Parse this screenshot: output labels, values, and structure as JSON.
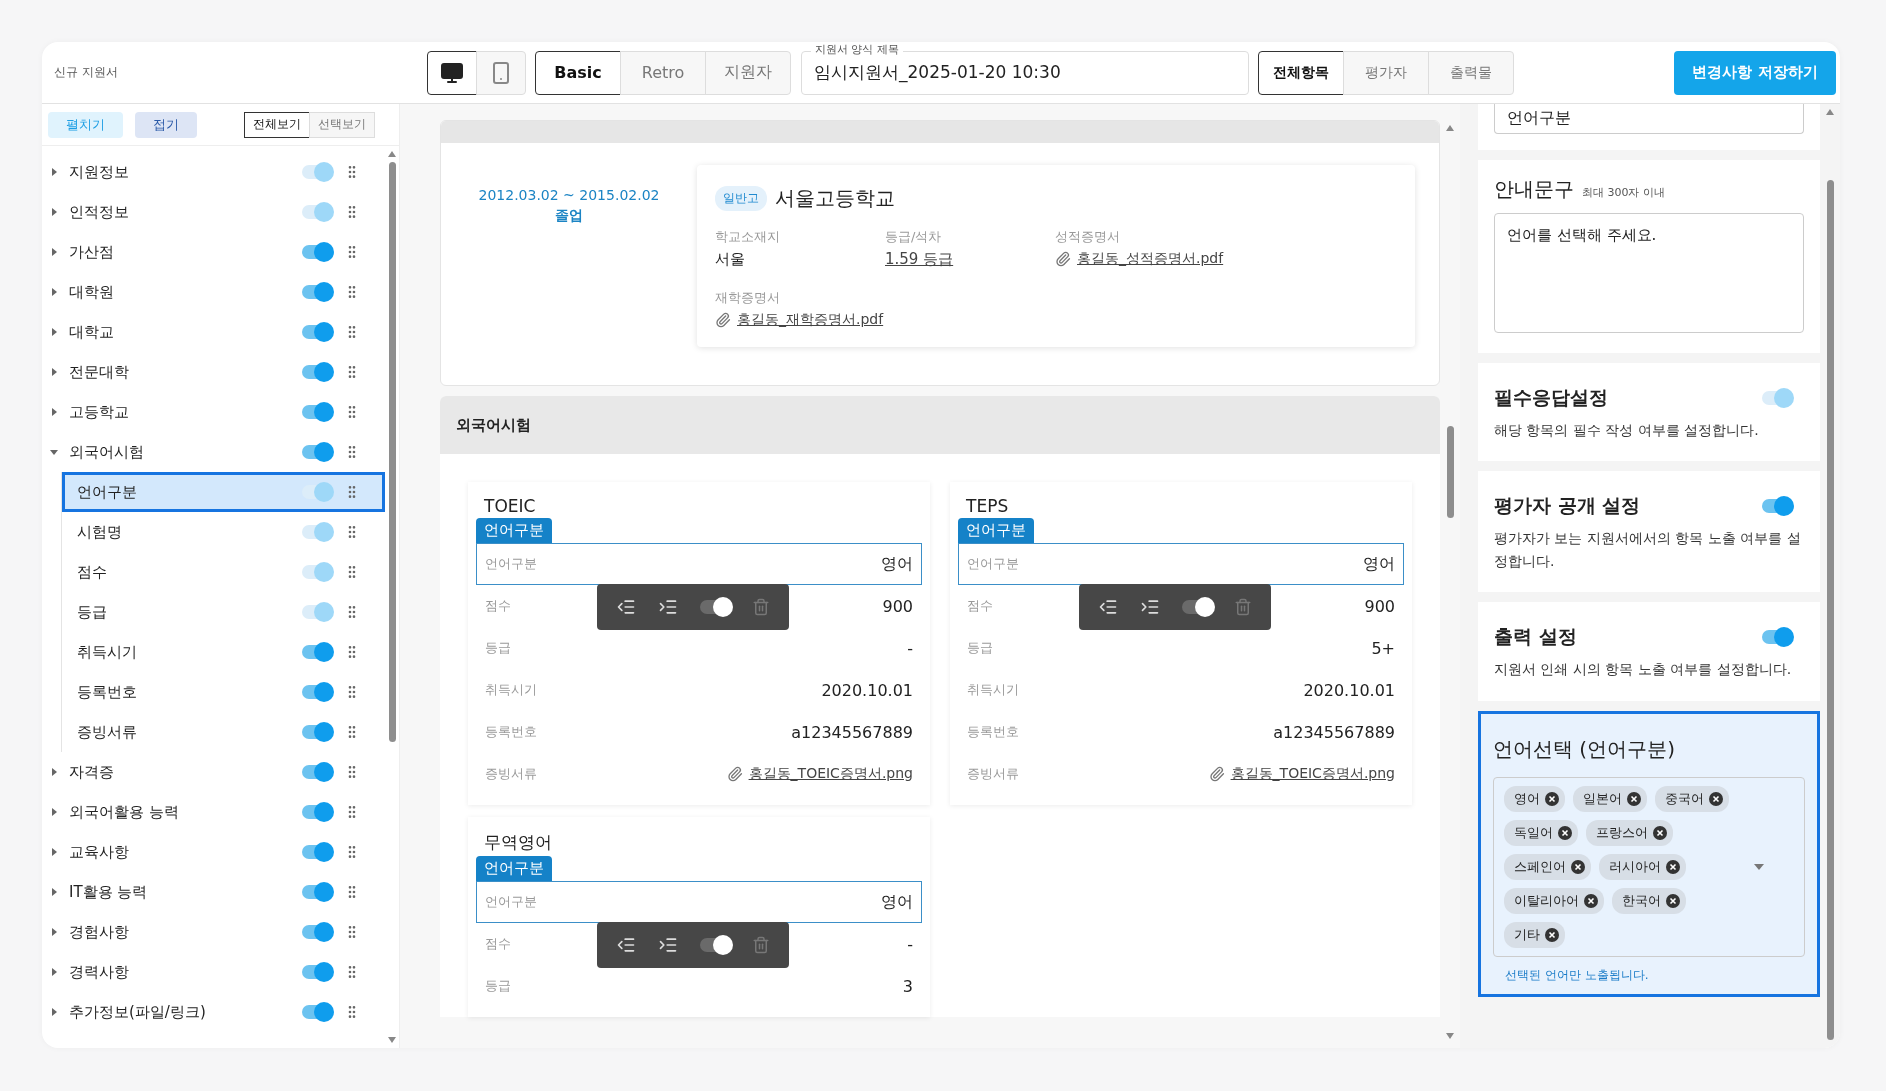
{
  "header": {
    "title": "신규 지원서",
    "view_modes": [
      {
        "kind": "desktop",
        "selected": true
      },
      {
        "kind": "mobile",
        "selected": false
      }
    ],
    "themes": [
      {
        "label": "Basic",
        "selected": true
      },
      {
        "label": "Retro",
        "selected": false
      },
      {
        "label": "지원자",
        "selected": false
      }
    ],
    "form_title": {
      "label": "지원서 양식 제목",
      "value": "임시지원서_2025-01-20 10:30"
    },
    "audiences": [
      {
        "label": "전체항목",
        "selected": true
      },
      {
        "label": "평가자",
        "selected": false
      },
      {
        "label": "출력물",
        "selected": false
      }
    ],
    "save_button": "변경사항 저장하기"
  },
  "sidebar": {
    "expand_button": "펼치기",
    "collapse_button": "접기",
    "view_tabs": [
      {
        "label": "전체보기",
        "selected": true
      },
      {
        "label": "선택보기",
        "selected": false
      }
    ],
    "items": [
      {
        "label": "지원정보",
        "expanded": false,
        "on": true,
        "disabled": true
      },
      {
        "label": "인적정보",
        "expanded": false,
        "on": true,
        "disabled": true
      },
      {
        "label": "가산점",
        "expanded": false,
        "on": true,
        "disabled": false
      },
      {
        "label": "대학원",
        "expanded": false,
        "on": true,
        "disabled": false
      },
      {
        "label": "대학교",
        "expanded": false,
        "on": true,
        "disabled": false
      },
      {
        "label": "전문대학",
        "expanded": false,
        "on": true,
        "disabled": false
      },
      {
        "label": "고등학교",
        "expanded": false,
        "on": true,
        "disabled": false
      },
      {
        "label": "외국어시험",
        "expanded": true,
        "on": true,
        "disabled": false,
        "children": [
          {
            "label": "언어구분",
            "selected": true,
            "on": true,
            "disabled": true
          },
          {
            "label": "시험명",
            "selected": false,
            "on": true,
            "disabled": true
          },
          {
            "label": "점수",
            "selected": false,
            "on": true,
            "disabled": true
          },
          {
            "label": "등급",
            "selected": false,
            "on": true,
            "disabled": true
          },
          {
            "label": "취득시기",
            "selected": false,
            "on": true,
            "disabled": false
          },
          {
            "label": "등록번호",
            "selected": false,
            "on": true,
            "disabled": false
          },
          {
            "label": "증빙서류",
            "selected": false,
            "on": true,
            "disabled": false
          }
        ]
      },
      {
        "label": "자격증",
        "expanded": false,
        "on": true,
        "disabled": false
      },
      {
        "label": "외국어활용 능력",
        "expanded": false,
        "on": true,
        "disabled": false
      },
      {
        "label": "교육사항",
        "expanded": false,
        "on": true,
        "disabled": false
      },
      {
        "label": "IT활용 능력",
        "expanded": false,
        "on": true,
        "disabled": false
      },
      {
        "label": "경험사항",
        "expanded": false,
        "on": true,
        "disabled": false
      },
      {
        "label": "경력사항",
        "expanded": false,
        "on": true,
        "disabled": false
      },
      {
        "label": "추가정보(파일/링크)",
        "expanded": false,
        "on": true,
        "disabled": false
      }
    ]
  },
  "education": {
    "period": "2012.03.02 ~ 2015.02.02",
    "status": "졸업",
    "badge": "일반고",
    "school": "서울고등학교",
    "fields": [
      {
        "label": "학교소재지",
        "value": "서울",
        "kind": "text"
      },
      {
        "label": "등급/석차",
        "value": "1.59 등급",
        "kind": "link"
      },
      {
        "label": "성적증명서",
        "value": "홍길동_성적증명서.pdf",
        "kind": "file"
      },
      {
        "label": "재학증명서",
        "value": "홍길동_재학증명서.pdf",
        "kind": "file"
      }
    ]
  },
  "foreign_section": {
    "title": "외국어시험",
    "cards": [
      {
        "title": "TOEIC",
        "badge": "언어구분",
        "toolbar": {
          "on": true
        },
        "rows": [
          {
            "label": "언어구분",
            "value": "영어",
            "kind": "text",
            "selected": true
          },
          {
            "label": "점수",
            "value": "900",
            "kind": "text",
            "selected": false
          },
          {
            "label": "등급",
            "value": "-",
            "kind": "text",
            "selected": false
          },
          {
            "label": "취득시기",
            "value": "2020.10.01",
            "kind": "text",
            "selected": false
          },
          {
            "label": "등록번호",
            "value": "a12345567889",
            "kind": "text",
            "selected": false
          },
          {
            "label": "증빙서류",
            "value": "홍길동_TOEIC증명서.png",
            "kind": "file",
            "selected": false
          }
        ]
      },
      {
        "title": "TEPS",
        "badge": "언어구분",
        "toolbar": {
          "on": true
        },
        "rows": [
          {
            "label": "언어구분",
            "value": "영어",
            "kind": "text",
            "selected": true
          },
          {
            "label": "점수",
            "value": "900",
            "kind": "text",
            "selected": false
          },
          {
            "label": "등급",
            "value": "5+",
            "kind": "text",
            "selected": false
          },
          {
            "label": "취득시기",
            "value": "2020.10.01",
            "kind": "text",
            "selected": false
          },
          {
            "label": "등록번호",
            "value": "a12345567889",
            "kind": "text",
            "selected": false
          },
          {
            "label": "증빙서류",
            "value": "홍길동_TOEIC증명서.png",
            "kind": "file",
            "selected": false
          }
        ]
      },
      {
        "title": "무역영어",
        "badge": "언어구분",
        "toolbar": {
          "on": true
        },
        "rows": [
          {
            "label": "언어구분",
            "value": "영어",
            "kind": "text",
            "selected": true
          },
          {
            "label": "점수",
            "value": "-",
            "kind": "text",
            "selected": false
          },
          {
            "label": "등급",
            "value": "3",
            "kind": "text",
            "selected": false
          }
        ]
      }
    ]
  },
  "settings_panel": {
    "name_value": "언어구분",
    "guide": {
      "title": "안내문구",
      "hint": "최대 300자 이내",
      "value": "언어를 선택해 주세요."
    },
    "options": [
      {
        "title": "필수응답설정",
        "description": "해당 항목의 필수 작성 여부를 설정합니다.",
        "on": true,
        "disabled": true
      },
      {
        "title": "평가자 공개 설정",
        "description": "평가자가 보는 지원서에서의 항목 노출 여부를 설정합니다.",
        "on": true,
        "disabled": false
      },
      {
        "title": "출력 설정",
        "description": "지원서 인쇄 시의 항목 노출 여부를 설정합니다.",
        "on": true,
        "disabled": false
      }
    ],
    "language_select": {
      "title": "언어선택 (언어구분)",
      "tags": [
        "영어",
        "일본어",
        "중국어",
        "독일어",
        "프랑스어",
        "스페인어",
        "러시아어",
        "이탈리아어",
        "한국어",
        "기타"
      ],
      "note": "선택된 언어만 노출됩니다."
    }
  }
}
